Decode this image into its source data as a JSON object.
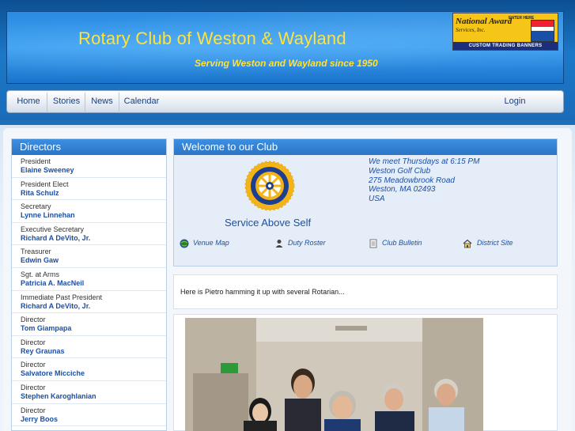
{
  "header": {
    "title": "Rotary Club of Weston & Wayland",
    "tagline": "Serving Weston and Wayland since 1950",
    "ad": {
      "brand": "National Award",
      "brand_sub": "Services, Inc.",
      "enter": "ENTER HERE",
      "strip": "CUSTOM TRADING BANNERS"
    }
  },
  "nav": {
    "items": [
      "Home",
      "Stories",
      "News",
      "Calendar"
    ],
    "login": "Login"
  },
  "sidebar": {
    "title": "Directors",
    "officers": [
      {
        "role": "President",
        "name": "Elaine Sweeney"
      },
      {
        "role": "President Elect",
        "name": "Rita Schulz"
      },
      {
        "role": "Secretary",
        "name": "Lynne Linnehan"
      },
      {
        "role": "Executive Secretary",
        "name": "Richard A DeVito, Jr."
      },
      {
        "role": "Treasurer",
        "name": "Edwin Gaw"
      },
      {
        "role": "Sgt. at Arms",
        "name": "Patricia A. MacNeil"
      },
      {
        "role": "Immediate Past President",
        "name": "Richard A DeVito, Jr."
      },
      {
        "role": "Director",
        "name": "Tom Giampapa"
      },
      {
        "role": "Director",
        "name": "Rey Graunas"
      },
      {
        "role": "Director",
        "name": "Salvatore Micciche"
      },
      {
        "role": "Director",
        "name": "Stephen Karoghlanian"
      },
      {
        "role": "Director",
        "name": "Jerry Boos"
      }
    ]
  },
  "welcome": {
    "title": "Welcome to our Club",
    "motto": "Service Above Self",
    "logo_text": "ROTARY INTERNATIONAL",
    "meeting": {
      "line1": "We meet Thursdays at 6:15 PM",
      "line2": "Weston Golf Club",
      "line3": "275 Meadowbrook Road",
      "line4": "Weston, MA 02493",
      "line5": "USA"
    },
    "links": [
      {
        "label": "Venue Map",
        "icon": "globe-icon"
      },
      {
        "label": "Duty Roster",
        "icon": "person-icon"
      },
      {
        "label": "Club Bulletin",
        "icon": "document-icon"
      },
      {
        "label": "District Site",
        "icon": "house-icon"
      }
    ]
  },
  "story": {
    "text": "Here is Pietro hamming it up with several Rotarian..."
  },
  "colors": {
    "title_yellow": "#ffe23a",
    "panel_blue": "#2b74c5",
    "link_blue": "#1b4fa6"
  }
}
